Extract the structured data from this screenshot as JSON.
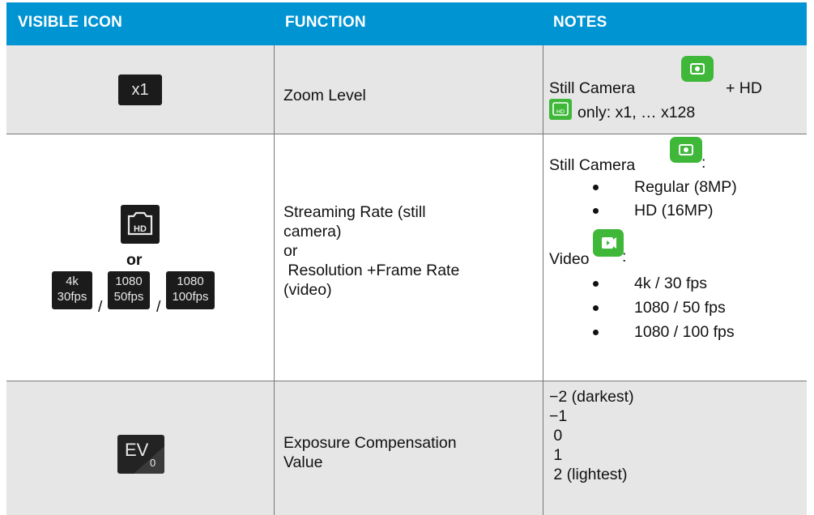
{
  "headers": {
    "icon": "VISIBLE ICON",
    "function": "FUNCTION",
    "notes": "NOTES"
  },
  "rows": [
    {
      "icon_text": "x1",
      "function": "Zoom Level",
      "notes": {
        "line1_a": "Still Camera",
        "line1_b": "+ HD",
        "line2": "only: x1, … x128"
      }
    },
    {
      "icon_or": "or",
      "tiles": [
        {
          "top": "4k",
          "bottom": "30fps"
        },
        {
          "top": "1080",
          "bottom": "50fps"
        },
        {
          "top": "1080",
          "bottom": "100fps"
        }
      ],
      "separator": "/",
      "function_lines": [
        "Streaming Rate (still",
        "camera)",
        "or",
        " Resolution +Frame Rate",
        "(video)"
      ],
      "notes": {
        "still_label": "Still Camera",
        "colon": ":",
        "still_items": [
          "Regular (8MP)",
          "HD (16MP)"
        ],
        "video_label": "Video",
        "video_items": [
          "4k / 30 fps",
          "1080 / 50 fps",
          "1080 / 100 fps"
        ]
      }
    },
    {
      "icon_text": "EV",
      "icon_sub": "0",
      "function_lines": [
        "Exposure Compensation",
        "Value"
      ],
      "notes_lines": [
        "−2 (darkest)",
        "−1",
        " 0",
        " 1",
        " 2 (lightest)"
      ]
    }
  ],
  "icons": [
    "hd-camera-icon",
    "still-camera-icon",
    "video-camera-icon",
    "hd-mode-icon"
  ],
  "colors": {
    "header": "#0094d2",
    "row_shade": "#e6e6e6",
    "mode_green": "#3fb83a",
    "tile_dark": "#1b1b1b"
  }
}
